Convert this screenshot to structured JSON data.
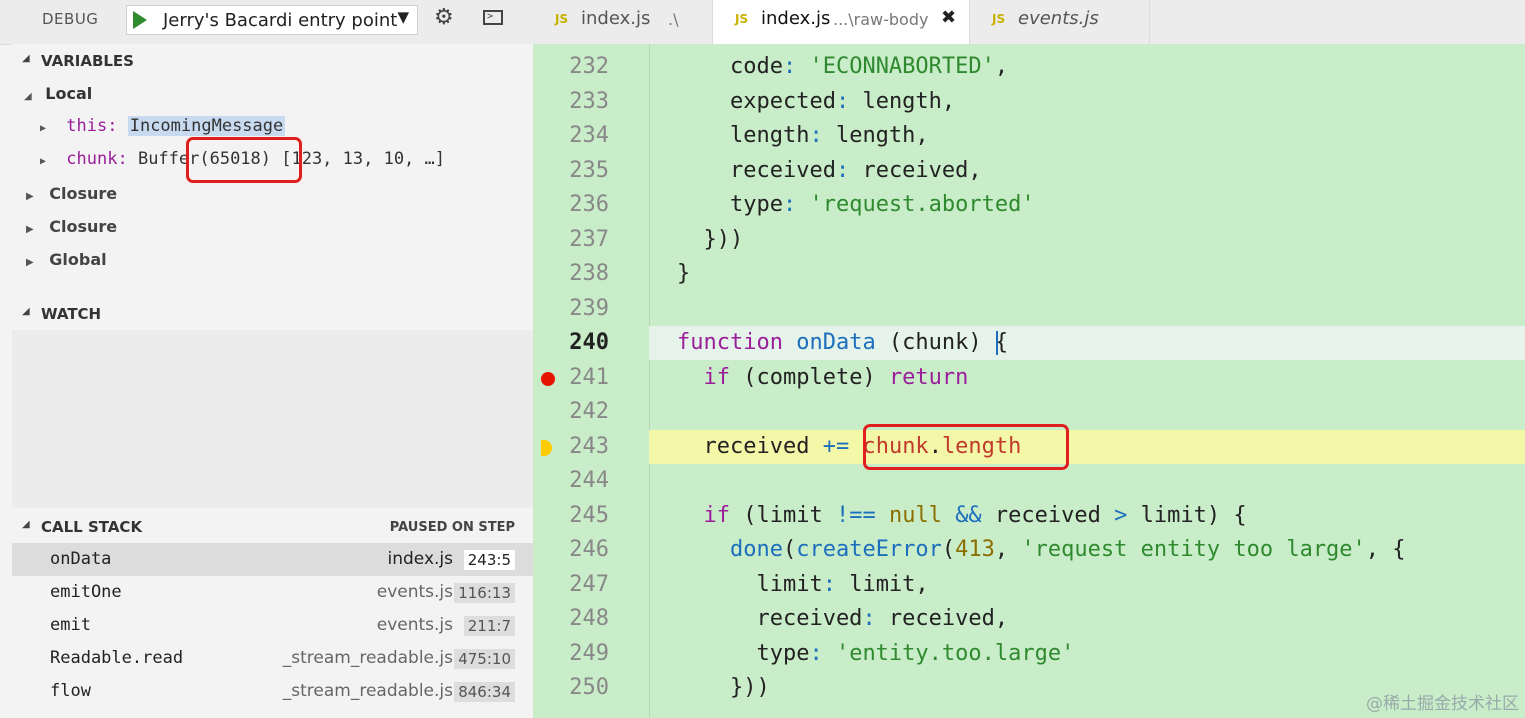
{
  "debug_toolbar": {
    "label": "DEBUG",
    "config_name": "Jerry's Bacardi entry point",
    "dropdown_arrow": "▼",
    "gear_icon": "⚙",
    "console_icon": ">"
  },
  "tabs": [
    {
      "badge": "JS",
      "name": "index.js",
      "desc": ".\\",
      "active": false,
      "italic": false
    },
    {
      "badge": "JS",
      "name": "index.js",
      "desc": "...\\raw-body",
      "active": true,
      "italic": false,
      "close": "✖"
    },
    {
      "badge": "JS",
      "name": "events.js",
      "desc": "",
      "active": false,
      "italic": true
    }
  ],
  "variables": {
    "title": "VARIABLES",
    "local_label": "Local",
    "this_name": "this:",
    "this_value": "IncomingMessage",
    "chunk_name": "chunk:",
    "chunk_value": "Buffer(65018) [123, 13, 10, …]",
    "scopes": [
      "Closure",
      "Closure",
      "Global"
    ]
  },
  "watch": {
    "title": "WATCH"
  },
  "call_stack": {
    "title": "CALL STACK",
    "status": "PAUSED ON STEP",
    "frames": [
      {
        "fn": "onData",
        "file": "index.js",
        "pos": "243:5"
      },
      {
        "fn": "emitOne",
        "file": "events.js",
        "pos": "116:13"
      },
      {
        "fn": "emit",
        "file": "events.js",
        "pos": "211:7"
      },
      {
        "fn": "Readable.read",
        "file": "_stream_readable.js",
        "pos": "475:10"
      },
      {
        "fn": "flow",
        "file": "_stream_readable.js",
        "pos": "846:34"
      }
    ]
  },
  "editor": {
    "lines": [
      {
        "n": "232",
        "segs": [
          [
            "pr",
            "    code"
          ],
          [
            "o",
            ":"
          ],
          [
            "s",
            " 'ECONNABORTED'"
          ],
          [
            "pr",
            ","
          ]
        ]
      },
      {
        "n": "233",
        "segs": [
          [
            "pr",
            "    expected"
          ],
          [
            "o",
            ":"
          ],
          [
            "pr",
            " length,"
          ]
        ]
      },
      {
        "n": "234",
        "segs": [
          [
            "pr",
            "    length"
          ],
          [
            "o",
            ":"
          ],
          [
            "pr",
            " length,"
          ]
        ]
      },
      {
        "n": "235",
        "segs": [
          [
            "pr",
            "    received"
          ],
          [
            "o",
            ":"
          ],
          [
            "pr",
            " received,"
          ]
        ]
      },
      {
        "n": "236",
        "segs": [
          [
            "pr",
            "    type"
          ],
          [
            "o",
            ":"
          ],
          [
            "s",
            " 'request.aborted'"
          ]
        ]
      },
      {
        "n": "237",
        "segs": [
          [
            "pr",
            "  }))"
          ]
        ]
      },
      {
        "n": "238",
        "segs": [
          [
            "pr",
            "}"
          ]
        ]
      },
      {
        "n": "239",
        "segs": []
      },
      {
        "n": "240",
        "segs": [
          [
            "k",
            "function"
          ],
          [
            "f",
            " onData"
          ],
          [
            "pr",
            " (chunk) {"
          ]
        ]
      },
      {
        "n": "241",
        "segs": [
          [
            "k",
            "  if"
          ],
          [
            "pr",
            " (complete) "
          ],
          [
            "k",
            "return"
          ]
        ]
      },
      {
        "n": "242",
        "segs": []
      },
      {
        "n": "243",
        "segs": [
          [
            "pr",
            "  received "
          ],
          [
            "o",
            "+="
          ],
          [
            "pr",
            " "
          ],
          [
            "r",
            "chunk"
          ],
          [
            "pr",
            "."
          ],
          [
            "r",
            "length"
          ]
        ]
      },
      {
        "n": "244",
        "segs": []
      },
      {
        "n": "245",
        "segs": [
          [
            "k",
            "  if"
          ],
          [
            "pr",
            " (limit "
          ],
          [
            "o",
            "!=="
          ],
          [
            "n",
            " null"
          ],
          [
            "pr",
            " "
          ],
          [
            "o",
            "&&"
          ],
          [
            "pr",
            " received "
          ],
          [
            "o",
            ">"
          ],
          [
            "pr",
            " limit) {"
          ]
        ]
      },
      {
        "n": "246",
        "segs": [
          [
            "f",
            "    done"
          ],
          [
            "pr",
            "("
          ],
          [
            "f",
            "createError"
          ],
          [
            "pr",
            "("
          ],
          [
            "n",
            "413"
          ],
          [
            "pr",
            ", "
          ],
          [
            "s",
            "'request entity too large'"
          ],
          [
            "pr",
            ", {"
          ]
        ]
      },
      {
        "n": "247",
        "segs": [
          [
            "pr",
            "      limit"
          ],
          [
            "o",
            ":"
          ],
          [
            "pr",
            " limit,"
          ]
        ]
      },
      {
        "n": "248",
        "segs": [
          [
            "pr",
            "      received"
          ],
          [
            "o",
            ":"
          ],
          [
            "pr",
            " received,"
          ]
        ]
      },
      {
        "n": "249",
        "segs": [
          [
            "pr",
            "      type"
          ],
          [
            "o",
            ":"
          ],
          [
            "s",
            " 'entity.too.large'"
          ]
        ]
      },
      {
        "n": "250",
        "segs": [
          [
            "pr",
            "    }))"
          ]
        ]
      }
    ],
    "current_line": "240",
    "breakpoint_line": "241",
    "paused_line": "243"
  },
  "watermark": "@稀土掘金技术社区",
  "colors": {
    "breakpoint": "#e51400",
    "paused": "#ffcc00",
    "annotation": "#e01e1e",
    "editor_bg": "#c9ecc9"
  }
}
